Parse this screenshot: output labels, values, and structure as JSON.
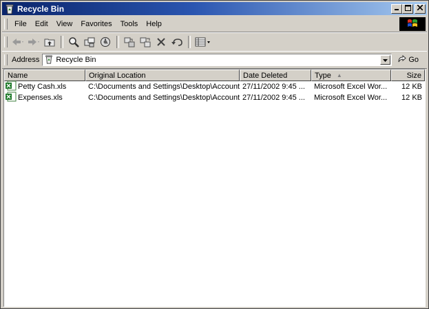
{
  "window": {
    "title": "Recycle Bin"
  },
  "menu": [
    "File",
    "Edit",
    "View",
    "Favorites",
    "Tools",
    "Help"
  ],
  "address": {
    "label": "Address",
    "value": "Recycle Bin",
    "go_label": "Go"
  },
  "columns": {
    "name": "Name",
    "original_location": "Original Location",
    "date_deleted": "Date Deleted",
    "type": "Type",
    "size": "Size"
  },
  "files": [
    {
      "name": "Petty Cash.xls",
      "original_location": "C:\\Documents and Settings\\Desktop\\Accounts",
      "date_deleted": "27/11/2002 9:45 ...",
      "type": "Microsoft Excel Wor...",
      "size": "12 KB"
    },
    {
      "name": "Expenses.xls",
      "original_location": "C:\\Documents and Settings\\Desktop\\Accounts",
      "date_deleted": "27/11/2002 9:45 ...",
      "type": "Microsoft Excel Wor...",
      "size": "12 KB"
    }
  ],
  "colors": {
    "titlebar_start": "#0a246a",
    "titlebar_end": "#a6caf0",
    "face": "#d4d0c8"
  },
  "icons": [
    "recycle-bin-icon",
    "minimize-icon",
    "maximize-icon",
    "close-icon",
    "windows-logo-icon",
    "back-icon",
    "forward-icon",
    "up-folder-icon",
    "search-icon",
    "folders-icon",
    "history-icon",
    "move-to-icon",
    "copy-to-icon",
    "delete-icon",
    "undo-icon",
    "views-icon",
    "excel-file-icon",
    "go-arrow-icon"
  ]
}
